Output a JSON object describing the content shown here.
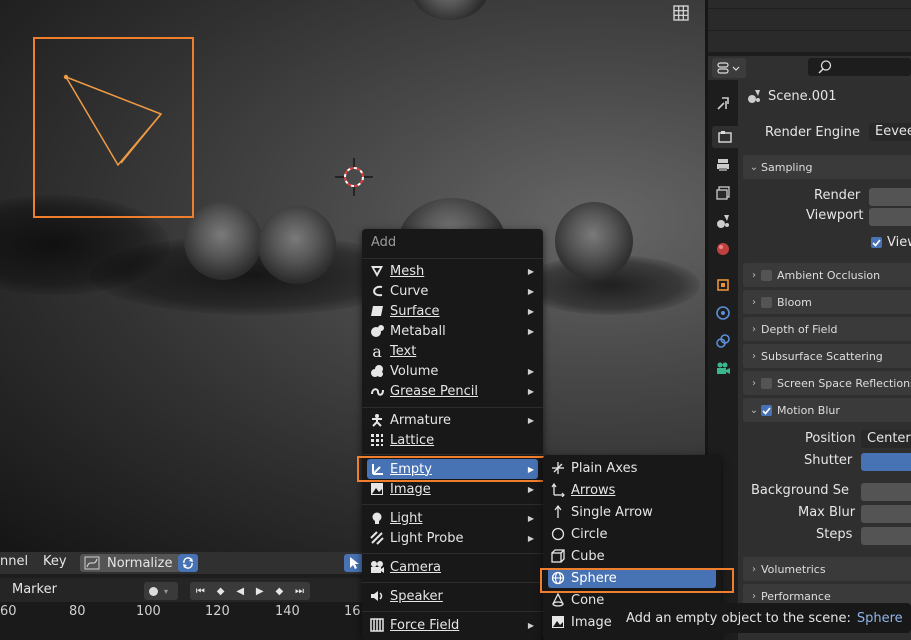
{
  "colors": {
    "accent": "#4772b3",
    "highlight_outline": "#ef7f2d",
    "menu_bg": "#181818",
    "panel_bg": "#2f2f2f"
  },
  "timeline": {
    "channel_label": "nnel",
    "key_label": "Key",
    "normalize_label": "Normalize",
    "marker_label": "Marker",
    "ticks": [
      "60",
      "80",
      "100",
      "120",
      "140",
      "16"
    ]
  },
  "add_menu": {
    "title": "Add",
    "items": [
      {
        "label": "Mesh",
        "icon": "mesh-icon"
      },
      {
        "label": "Curve",
        "icon": "curve-icon"
      },
      {
        "label": "Surface",
        "icon": "surface-icon"
      },
      {
        "label": "Metaball",
        "icon": "metaball-icon"
      },
      {
        "label": "Text",
        "icon": "text-icon"
      },
      {
        "label": "Volume",
        "icon": "volume-icon"
      },
      {
        "label": "Grease Pencil",
        "icon": "grease-pencil-icon"
      },
      {
        "label": "Armature",
        "icon": "armature-icon"
      },
      {
        "label": "Lattice",
        "icon": "lattice-icon"
      },
      {
        "label": "Empty",
        "icon": "empty-icon"
      },
      {
        "label": "Image",
        "icon": "image-icon"
      },
      {
        "label": "Light",
        "icon": "light-icon"
      },
      {
        "label": "Light Probe",
        "icon": "light-probe-icon"
      },
      {
        "label": "Camera",
        "icon": "camera-icon"
      },
      {
        "label": "Speaker",
        "icon": "speaker-icon"
      },
      {
        "label": "Force Field",
        "icon": "force-field-icon"
      }
    ]
  },
  "empty_submenu": {
    "items": [
      {
        "label": "Plain Axes",
        "icon": "plain-axes-icon"
      },
      {
        "label": "Arrows",
        "icon": "arrows-icon"
      },
      {
        "label": "Single Arrow",
        "icon": "single-arrow-icon"
      },
      {
        "label": "Circle",
        "icon": "circle-icon"
      },
      {
        "label": "Cube",
        "icon": "cube-icon"
      },
      {
        "label": "Sphere",
        "icon": "sphere-icon"
      },
      {
        "label": "Cone",
        "icon": "cone-icon"
      },
      {
        "label": "Image",
        "icon": "image-icon"
      }
    ]
  },
  "tooltip": {
    "text": "Add an empty object to the scene:",
    "value": "Sphere"
  },
  "properties": {
    "scene_name": "Scene.001",
    "render_engine_label": "Render Engine",
    "render_engine_value": "Eevee",
    "sampling": {
      "title": "Sampling",
      "render_label": "Render",
      "viewport_label": "Viewport",
      "viewport_denoise_label": "View"
    },
    "sections": {
      "ambient_occlusion": "Ambient Occlusion",
      "bloom": "Bloom",
      "depth_of_field": "Depth of Field",
      "subsurface_scattering": "Subsurface Scattering",
      "ssr": "Screen Space Reflections",
      "motion_blur": "Motion Blur",
      "volumetrics": "Volumetrics",
      "performance": "Performance"
    },
    "motion_blur": {
      "position_label": "Position",
      "position_value": "Center",
      "shutter_label": "Shutter",
      "background_label": "Background Se",
      "max_blur_label": "Max Blur",
      "steps_label": "Steps"
    }
  }
}
